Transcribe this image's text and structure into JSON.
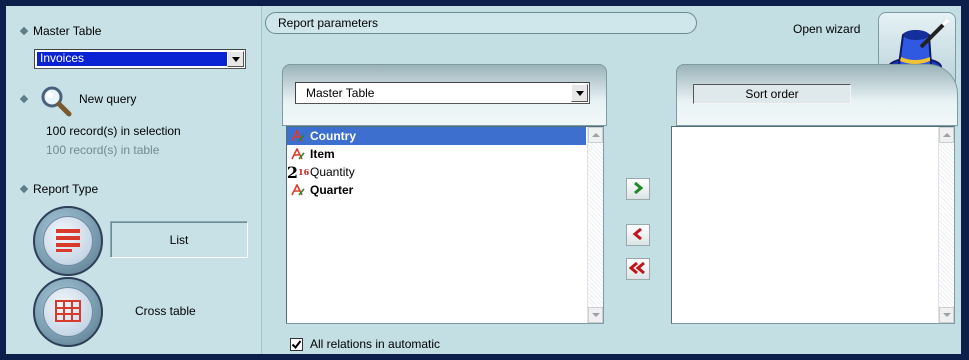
{
  "left": {
    "master_table_label": "Master Table",
    "master_table_value": "Invoices",
    "new_query_label": "New query",
    "records_selection": "100 record(s) in selection",
    "records_table": "100 record(s) in table",
    "report_type_label": "Report Type",
    "list_label": "List",
    "cross_table_label": "Cross table"
  },
  "header": {
    "report_parameters": "Report parameters",
    "open_wizard": "Open wizard"
  },
  "fields_panel": {
    "table_select": "Master Table",
    "fields": [
      {
        "name": "Country",
        "type": "text",
        "bold": true,
        "selected": true
      },
      {
        "name": "Item",
        "type": "text",
        "bold": true,
        "selected": false
      },
      {
        "name": "Quantity",
        "type": "number",
        "bold": false,
        "selected": false,
        "icon_text": "2",
        "icon_sup": "16"
      },
      {
        "name": "Quarter",
        "type": "text",
        "bold": true,
        "selected": false
      }
    ]
  },
  "sort_panel": {
    "caption": "Sort order"
  },
  "footer": {
    "all_relations_label": "All relations in automatic",
    "all_relations_checked": true
  },
  "colors": {
    "selection": "#3d6fcf",
    "arrow_green": "#1e8a2a",
    "arrow_red": "#c0151b",
    "panel_bg": "#c3dfe4"
  }
}
